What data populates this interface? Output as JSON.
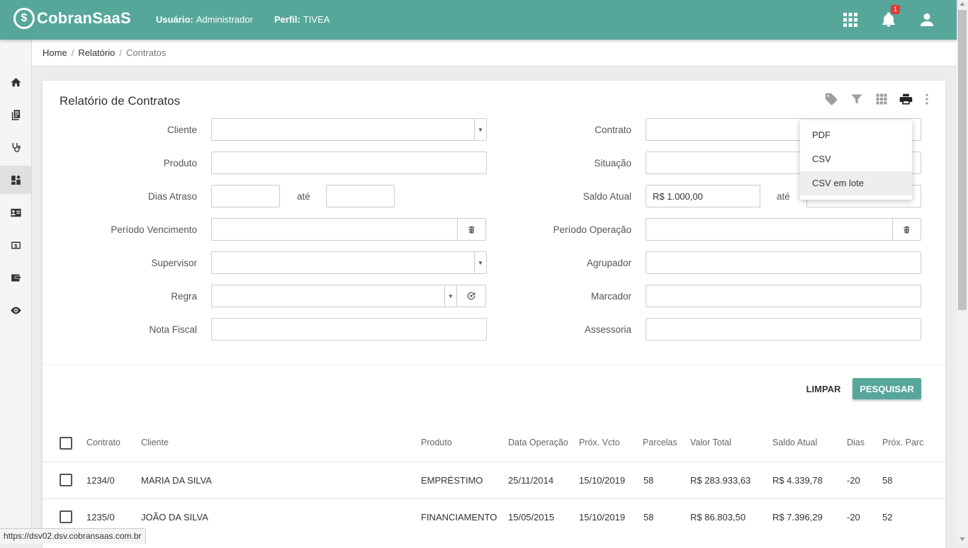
{
  "header": {
    "app_name": "CobranSaaS",
    "logo_mark": "$",
    "user_label": "Usuário:",
    "user_value": "Administrador",
    "profile_label": "Perfil:",
    "profile_value": "TIVEA",
    "notification_count": "1"
  },
  "sidebar": {
    "items": [
      "home-icon",
      "book-icon",
      "stethoscope-icon",
      "dashboard-icon",
      "contact-card-icon",
      "money-icon",
      "wallet-icon",
      "eye-icon"
    ],
    "active_index": 3
  },
  "breadcrumb": {
    "items": [
      "Home",
      "Relatório"
    ],
    "current": "Contratos",
    "separator": "/"
  },
  "card": {
    "title": "Relatório de Contratos"
  },
  "form": {
    "cliente": {
      "label": "Cliente",
      "value": ""
    },
    "produto": {
      "label": "Produto",
      "value": ""
    },
    "dias_atraso": {
      "label": "Dias Atraso",
      "from": "",
      "to": ""
    },
    "ate": "até",
    "periodo_vencimento": {
      "label": "Período Vencimento",
      "value": ""
    },
    "supervisor": {
      "label": "Supervisor",
      "value": ""
    },
    "regra": {
      "label": "Regra",
      "value": ""
    },
    "nota_fiscal": {
      "label": "Nota Fiscal",
      "value": ""
    },
    "contrato": {
      "label": "Contrato",
      "value": ""
    },
    "situacao": {
      "label": "Situação",
      "value": ""
    },
    "saldo_atual": {
      "label": "Saldo Atual",
      "from": "R$ 1.000,00",
      "to": ""
    },
    "periodo_operacao": {
      "label": "Período Operação",
      "value": ""
    },
    "agrupador": {
      "label": "Agrupador",
      "value": ""
    },
    "marcador": {
      "label": "Marcador",
      "value": ""
    },
    "assessoria": {
      "label": "Assessoria",
      "value": ""
    }
  },
  "actions": {
    "clear": "LIMPAR",
    "search": "PESQUISAR"
  },
  "export_menu": {
    "items": [
      "PDF",
      "CSV",
      "CSV em lote"
    ],
    "hovered_index": 2
  },
  "table": {
    "headers": [
      "Contrato",
      "Cliente",
      "Produto",
      "Data Operação",
      "Próx. Vcto",
      "Parcelas",
      "Valor Total",
      "Saldo Atual",
      "Dias",
      "Próx. Parc"
    ],
    "rows": [
      [
        "1234/0",
        "MARIA DA SILVA",
        "EMPRÉSTIMO",
        "25/11/2014",
        "15/10/2019",
        "58",
        "R$ 283.933,63",
        "R$ 4.339,78",
        "-20",
        "58"
      ],
      [
        "1235/0",
        "JOÃO DA SILVA",
        "FINANCIAMENTO",
        "15/05/2015",
        "15/10/2019",
        "58",
        "R$ 86.803,50",
        "R$ 7.396,29",
        "-20",
        "52"
      ]
    ]
  },
  "status_url": "https://dsv02.dsv.cobransaas.com.br",
  "colors": {
    "primary": "#56a79a",
    "badge": "#e53935"
  }
}
